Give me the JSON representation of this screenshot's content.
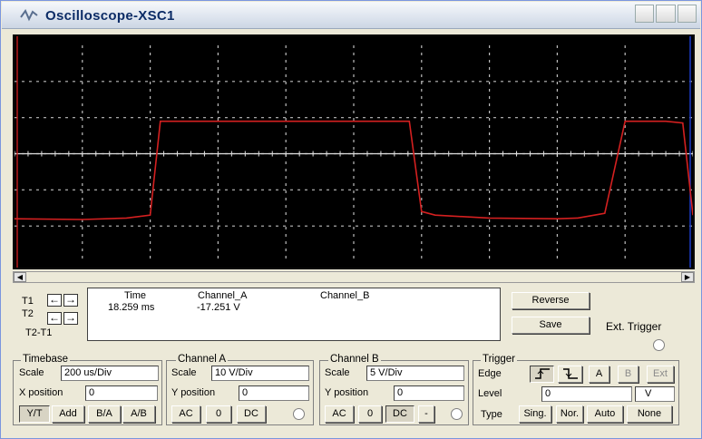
{
  "window": {
    "title": "Oscilloscope-XSC1"
  },
  "chart_data": {
    "type": "line",
    "title": "",
    "xlabel": "",
    "ylabel": "",
    "x_divisions": 10,
    "y_divisions": 6,
    "xlim": [
      0,
      10
    ],
    "ylim": [
      -3,
      3
    ],
    "grid": true,
    "series": [
      {
        "color": "#d42020",
        "x": [
          0.0,
          1.0,
          1.65,
          2.0,
          2.15,
          3.0,
          4.0,
          5.0,
          5.82,
          6.0,
          6.2,
          7.0,
          8.0,
          8.3,
          8.7,
          9.0,
          9.6,
          9.85,
          10.0
        ],
        "y": [
          -1.8,
          -1.82,
          -1.78,
          -1.7,
          0.9,
          0.9,
          0.9,
          0.9,
          0.9,
          -1.6,
          -1.7,
          -1.78,
          -1.8,
          -1.78,
          -1.65,
          0.9,
          0.9,
          0.85,
          -1.7
        ]
      }
    ]
  },
  "readout": {
    "headers": {
      "time": "Time",
      "channel_a": "Channel_A",
      "channel_b": "Channel_B"
    },
    "rows": [
      {
        "label": "T1",
        "time": "18.259 ms",
        "channel_a": "-17.251 V",
        "channel_b": ""
      },
      {
        "label": "T2",
        "time": "",
        "channel_a": "",
        "channel_b": ""
      }
    ],
    "diff_label": "T2-T1"
  },
  "buttons": {
    "reverse": "Reverse",
    "save": "Save",
    "ext_trigger": "Ext. Trigger"
  },
  "timebase": {
    "label": "Timebase",
    "scale_label": "Scale",
    "scale": "200 us/Div",
    "xpos_label": "X position",
    "xpos": "0",
    "modes": [
      "Y/T",
      "Add",
      "B/A",
      "A/B"
    ]
  },
  "channel_a": {
    "label": "Channel A",
    "scale_label": "Scale",
    "scale": "10  V/Div",
    "ypos_label": "Y position",
    "ypos": "0",
    "coupling": [
      "AC",
      "0",
      "DC"
    ]
  },
  "channel_b": {
    "label": "Channel B",
    "scale_label": "Scale",
    "scale": "5  V/Div",
    "ypos_label": "Y position",
    "ypos": "0",
    "coupling": [
      "AC",
      "0",
      "DC",
      "-"
    ]
  },
  "trigger": {
    "label": "Trigger",
    "edge_label": "Edge",
    "sources": [
      "A",
      "B",
      "Ext"
    ],
    "level_label": "Level",
    "level": "0",
    "level_unit": "V",
    "type_label": "Type",
    "types": [
      "Sing.",
      "Nor.",
      "Auto",
      "None"
    ]
  }
}
